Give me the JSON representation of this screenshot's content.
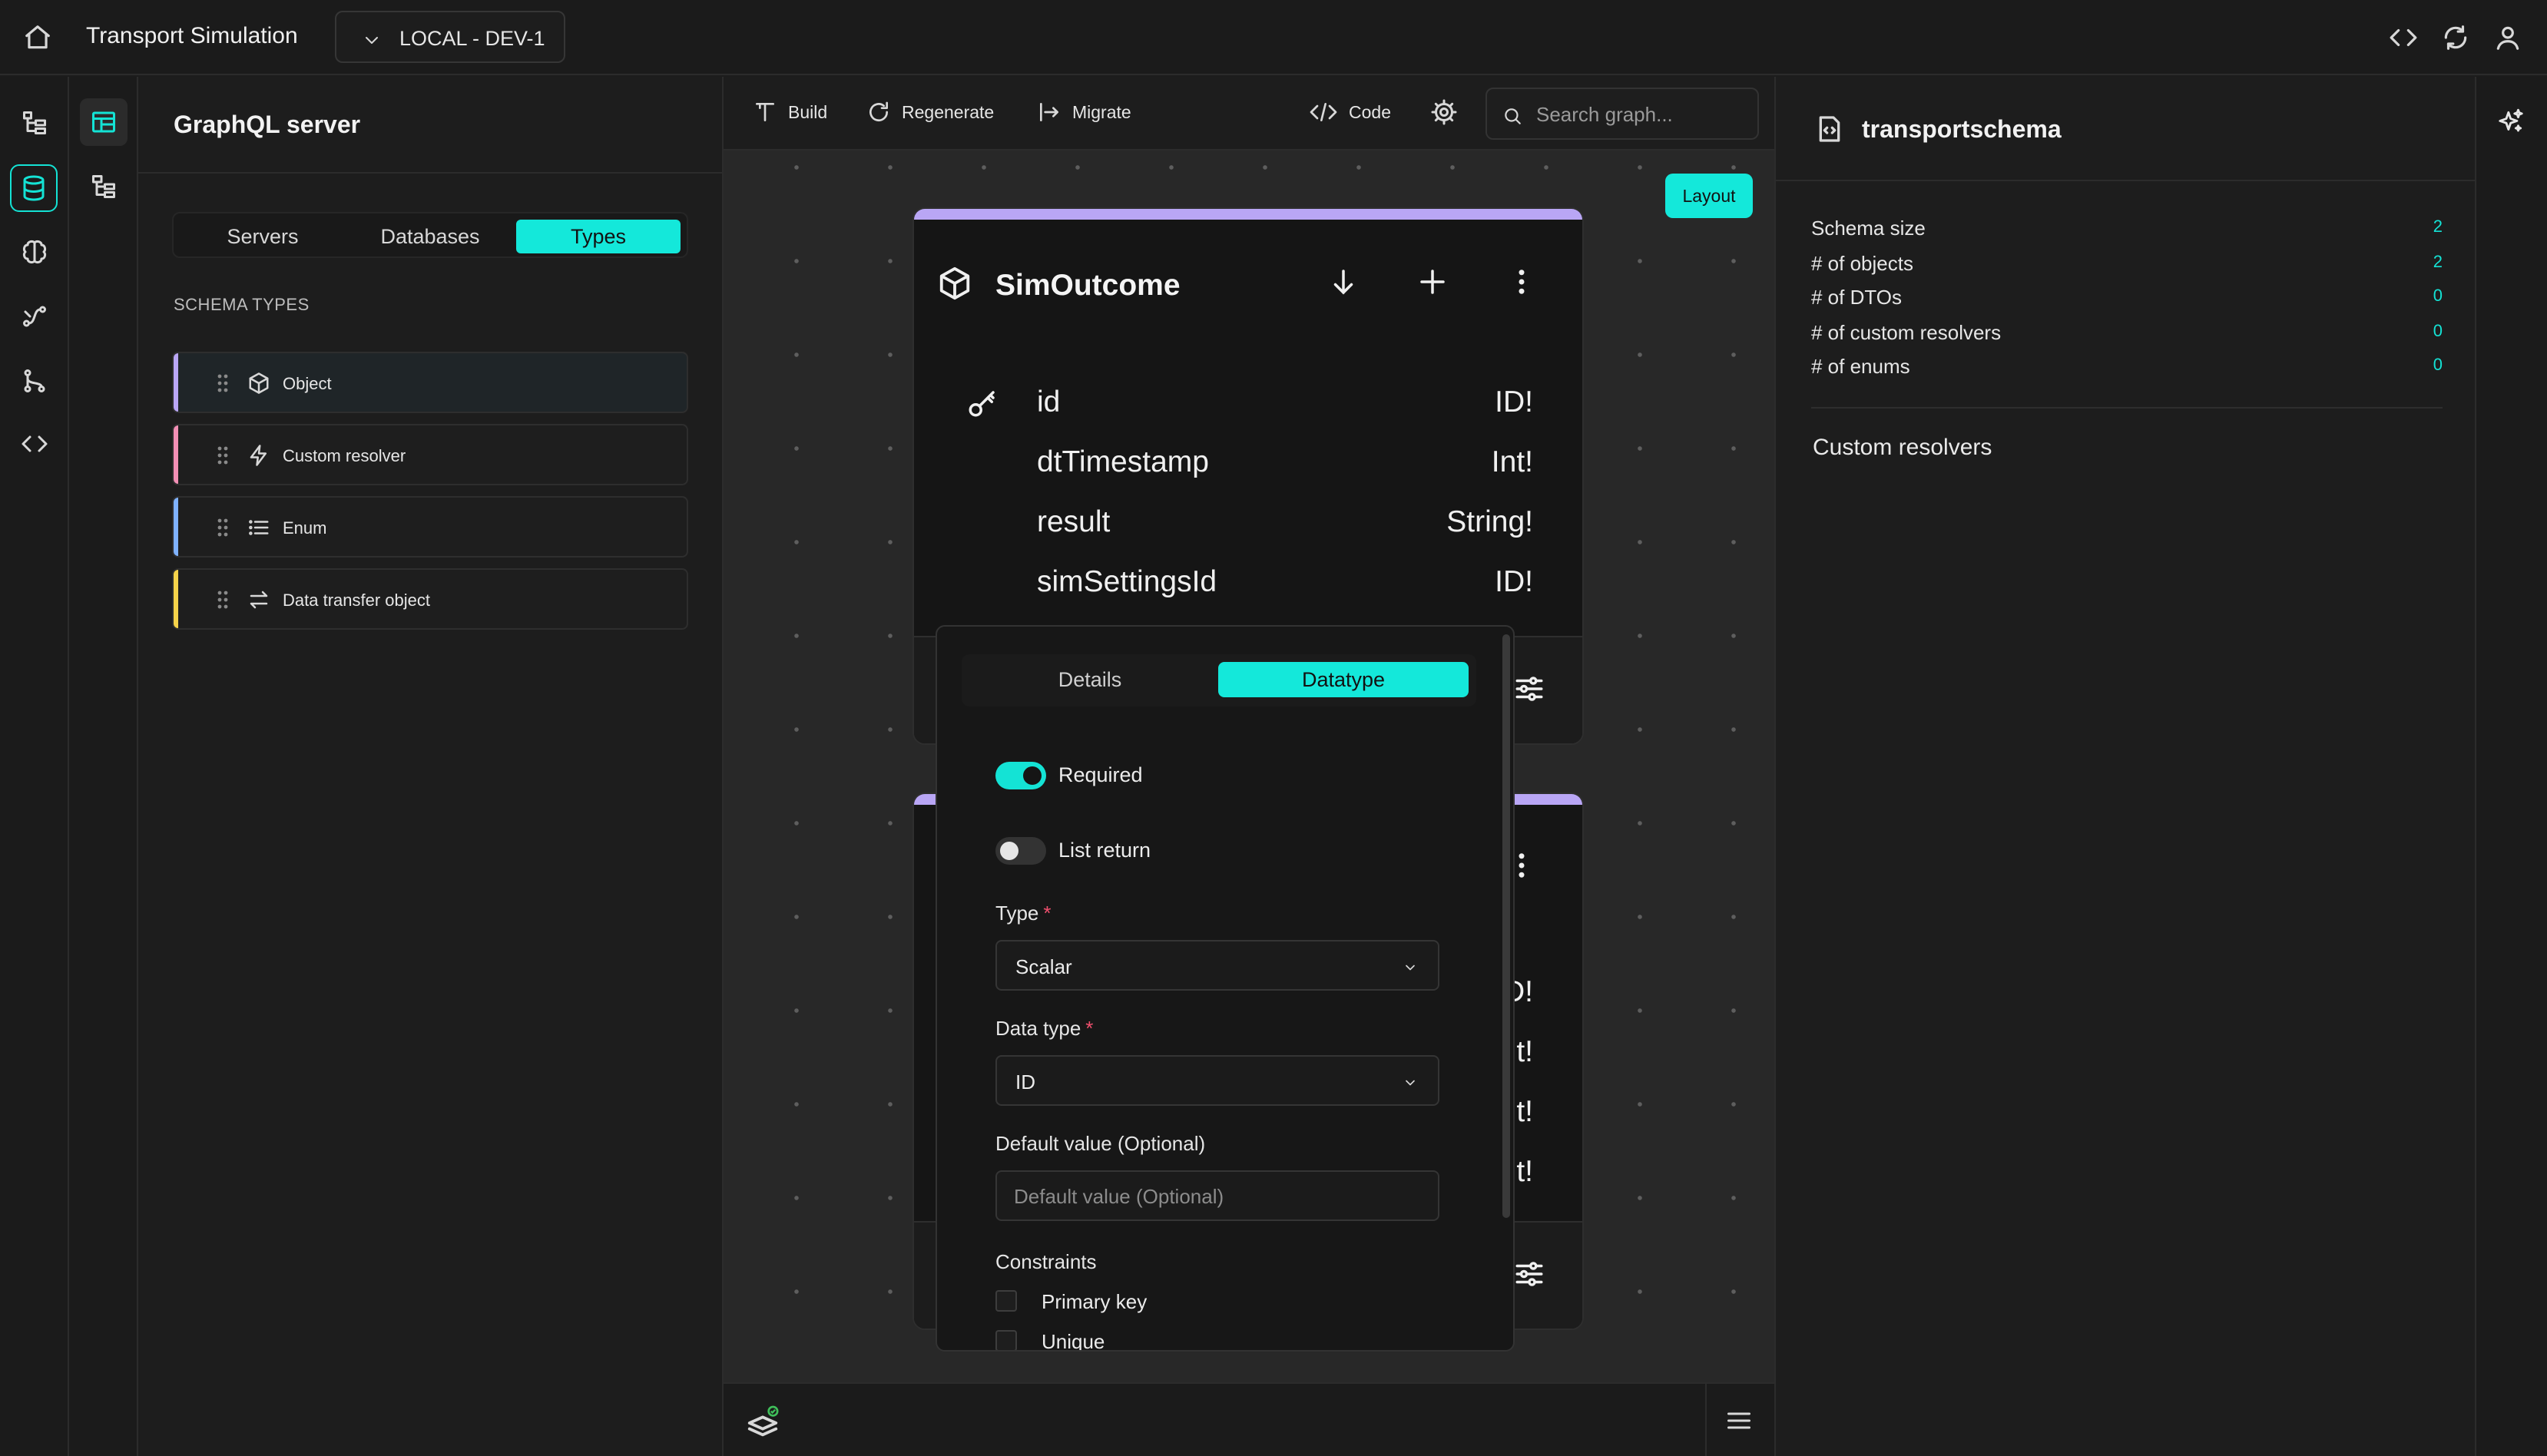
{
  "header": {
    "app_title": "Transport Simulation",
    "environment": "LOCAL - DEV-1"
  },
  "left_panel": {
    "title": "GraphQL server",
    "tabs": [
      {
        "label": "Servers",
        "active": false
      },
      {
        "label": "Databases",
        "active": false
      },
      {
        "label": "Types",
        "active": true
      }
    ],
    "section_label": "SCHEMA TYPES",
    "schema_types": [
      {
        "label": "Object",
        "icon": "cube-icon",
        "color": "#b9a6f5"
      },
      {
        "label": "Custom resolver",
        "icon": "lightning-icon",
        "color": "#f28fb5"
      },
      {
        "label": "Enum",
        "icon": "list-icon",
        "color": "#7fb2ff"
      },
      {
        "label": "Data transfer object",
        "icon": "swap-arrows-icon",
        "color": "#f5d34a"
      }
    ]
  },
  "toolbar": {
    "build": "Build",
    "regenerate": "Regenerate",
    "migrate": "Migrate",
    "code": "Code",
    "search_placeholder": "Search graph..."
  },
  "canvas": {
    "layout_button": "Layout",
    "node": {
      "name": "SimOutcome",
      "fields": [
        {
          "name": "id",
          "type": "ID!",
          "primary_key": true
        },
        {
          "name": "dtTimestamp",
          "type": "Int!"
        },
        {
          "name": "result",
          "type": "String!"
        },
        {
          "name": "simSettingsId",
          "type": "ID!"
        }
      ]
    },
    "node2_visible_types": [
      "D!",
      "t!",
      "t!",
      "t!"
    ]
  },
  "popover": {
    "tabs": [
      {
        "label": "Details",
        "active": false
      },
      {
        "label": "Datatype",
        "active": true
      }
    ],
    "required_label": "Required",
    "required_on": true,
    "list_return_label": "List return",
    "list_return_on": false,
    "type_label": "Type",
    "type_value": "Scalar",
    "data_type_label": "Data type",
    "data_type_value": "ID",
    "default_label": "Default value (Optional)",
    "default_placeholder": "Default value (Optional)",
    "constraints_label": "Constraints",
    "constraints": [
      {
        "label": "Primary key",
        "checked": false
      },
      {
        "label": "Unique",
        "checked": false
      }
    ]
  },
  "right_panel": {
    "schema_name": "transportschema",
    "stats": [
      {
        "label": "Schema size",
        "value": "2"
      },
      {
        "label": "# of objects",
        "value": "2"
      },
      {
        "label": "# of DTOs",
        "value": "0"
      },
      {
        "label": "# of custom resolvers",
        "value": "0"
      },
      {
        "label": "# of enums",
        "value": "0"
      }
    ],
    "custom_resolvers_title": "Custom resolvers"
  },
  "colors": {
    "accent": "#14e8da",
    "object_strip": "#b9a6f5",
    "required_star": "#f0506e"
  }
}
